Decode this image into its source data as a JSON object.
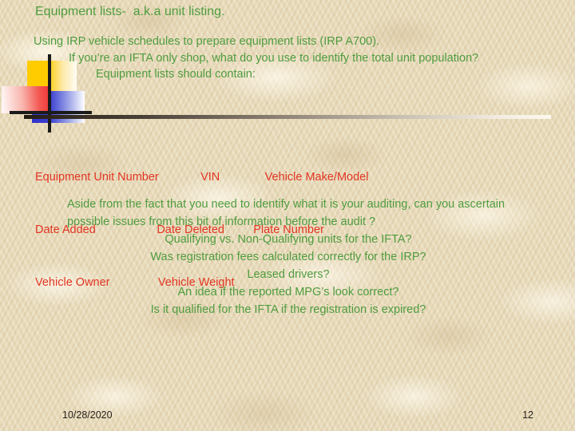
{
  "slide": {
    "title": "Equipment lists-  a.k.a unit listing.",
    "colors": {
      "background": "#e9dcbb",
      "heading_green": "#4f9c3f",
      "field_red": "#e23522",
      "footer_text": "#26201a",
      "clipart_yellow": "#ffcc00",
      "clipart_blue": "#3333cc",
      "clipart_red": "#f03030",
      "clipart_cross": "#1a1a1a"
    }
  },
  "intro": {
    "line1": "Using IRP vehicle schedules to prepare equipment lists (IRP A700).",
    "line2": "If you’re an IFTA only shop, what do you use to identify the total unit population?",
    "line3": "Equipment lists should contain:"
  },
  "fields": {
    "rows": [
      "Equipment Unit Number             VIN              Vehicle Make/Model",
      "Date Added                   Date Deleted         Plate Number",
      "Vehicle Owner               Vehicle Weight"
    ],
    "columns": {
      "col1": [
        "Equipment Unit Number",
        "Date Added",
        "Vehicle Owner"
      ],
      "col2": [
        "VIN",
        "Date Deleted",
        "Vehicle Weight"
      ],
      "col3": [
        "Vehicle Make/Model",
        "Plate Number",
        ""
      ]
    }
  },
  "questions": {
    "lead": "Aside from the fact that you need to identify what it is your auditing, can you ascertain possible issues from this bit of information before the audit ?",
    "items": [
      "Qualifying vs. Non-Qualifying units for the IFTA?",
      "Was registration fees calculated correctly for the IRP?",
      "Leased drivers?",
      "An idea if the reported MPG’s look correct?",
      "Is it qualified for the IFTA if the registration is expired?"
    ]
  },
  "footer": {
    "date": "10/28/2020",
    "page_number": "12"
  }
}
